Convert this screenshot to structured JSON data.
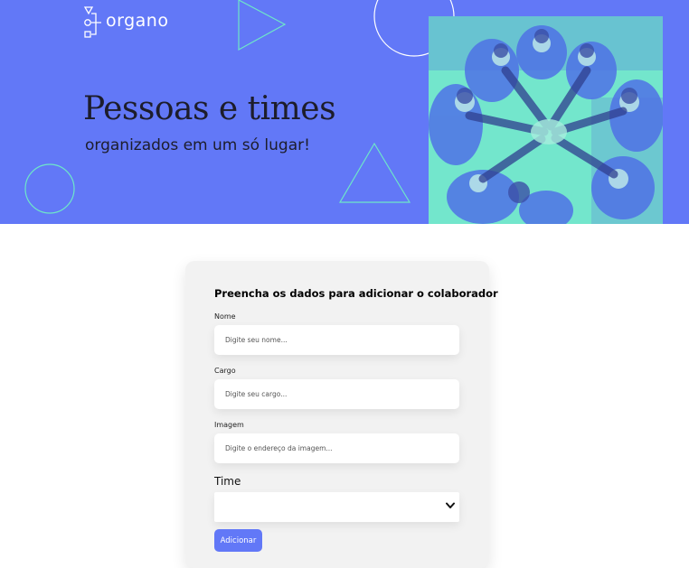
{
  "banner": {
    "logo_text": "organo",
    "headline": "Pessoas e times",
    "subheadline": "organizados em um só lugar!",
    "photo_alt": "team-hands-photo"
  },
  "form": {
    "title": "Preencha os dados para adicionar o colaborador",
    "fields": [
      {
        "label": "Nome",
        "placeholder": "Digite seu nome..."
      },
      {
        "label": "Cargo",
        "placeholder": "Digite seu cargo..."
      },
      {
        "label": "Imagem",
        "placeholder": "Digite o endereço da imagem..."
      }
    ],
    "time": {
      "label": "Time",
      "selected": ""
    },
    "submit_label": "Adicionar"
  },
  "colors": {
    "banner_bg": "#6278F7",
    "accent_teal": "#6EE7C9",
    "card_bg": "#F2F2F2",
    "button_bg": "#6278F7"
  }
}
